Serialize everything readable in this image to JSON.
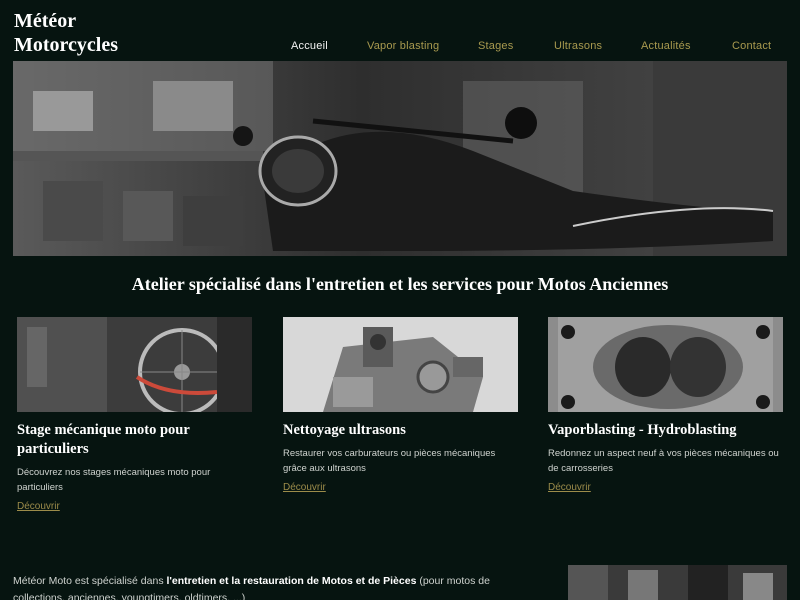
{
  "site": {
    "brand_line1": "Météor",
    "brand_line2": "Motorcycles"
  },
  "nav": {
    "items": [
      {
        "label": "Accueil",
        "active": true
      },
      {
        "label": "Vapor blasting",
        "active": false
      },
      {
        "label": "Stages",
        "active": false
      },
      {
        "label": "Ultrasons",
        "active": false
      },
      {
        "label": "Actualités",
        "active": false
      },
      {
        "label": "Contact",
        "active": false
      }
    ]
  },
  "hero": {
    "image": "vintage motorcycle in workshop (black and white photo)"
  },
  "tagline": "Atelier spécialisé dans l'entretien et les services pour Motos Anciennes",
  "cards": [
    {
      "title": "Stage mécanique moto pour particuliers",
      "text": "Découvrez nos stages mécaniques moto pour particuliers",
      "link": "Découvrir"
    },
    {
      "title": "Nettoyage ultrasons",
      "text": "Restaurer vos carburateurs ou pièces mécaniques grâce aux ultrasons",
      "link": "Découvrir"
    },
    {
      "title": "Vaporblasting - Hydroblasting",
      "text": "Redonnez un aspect neuf à vos pièces mécaniques ou de carrosseries",
      "link": "Découvrir"
    }
  ],
  "about": {
    "lead": "Météor Moto est spécialisé dans ",
    "bold": "l'entretien et la restauration de Motos et de Pièces",
    "tail": " (pour motos de collections, anciennes, youngtimers, oldtimers, ...)"
  },
  "colors": {
    "background": "#061410",
    "nav_link": "#a99a4f",
    "nav_active": "#f2f2f2",
    "link": "#9c8c4a"
  }
}
